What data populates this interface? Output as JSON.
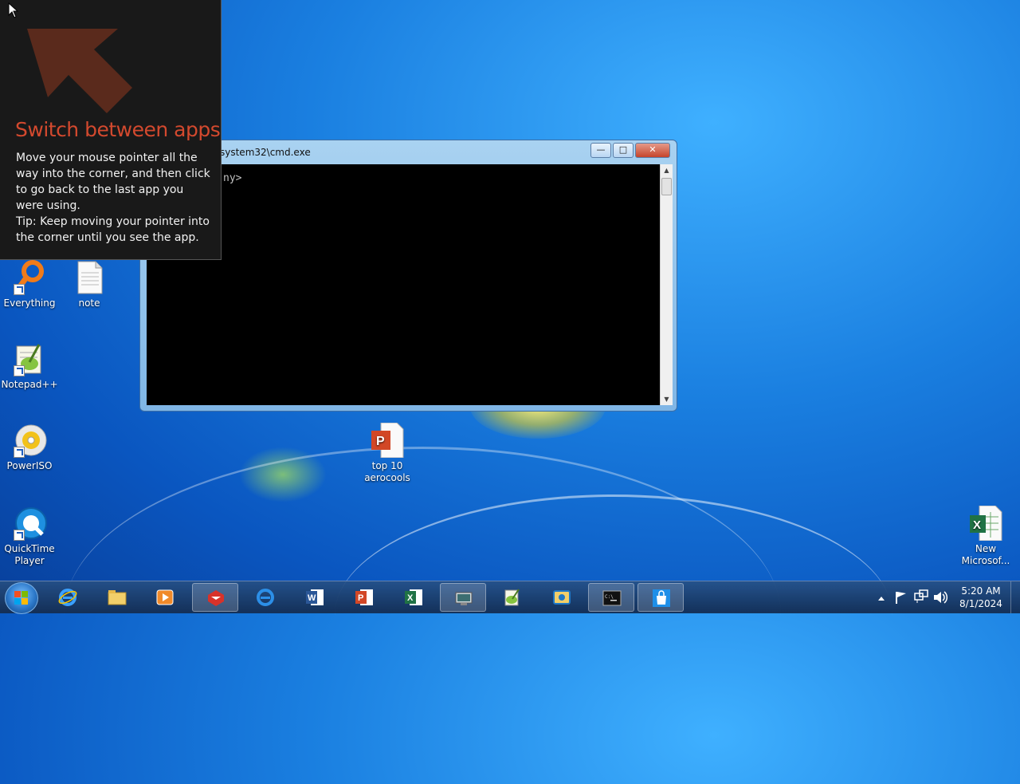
{
  "tip": {
    "title": "Switch between apps",
    "body": "Move your mouse pointer all the way into the corner, and then click to go back to the last app you were using.",
    "tip": "Tip: Keep moving your pointer into the corner until you see the app."
  },
  "cmd": {
    "title": "system32\\cmd.exe",
    "prompt": "ny>",
    "minimize": "—",
    "maximize": "□",
    "close": "✕"
  },
  "desktop_icons": [
    {
      "label": "Everything",
      "icon": "everything-icon"
    },
    {
      "label": "note",
      "icon": "text-file-icon"
    },
    {
      "label": "Notepad++",
      "icon": "notepad-plus-plus-icon"
    },
    {
      "label": "PowerISO",
      "icon": "poweriso-icon"
    },
    {
      "label": "QuickTime Player",
      "icon": "quicktime-icon"
    },
    {
      "label": "top 10 aerocools",
      "icon": "powerpoint-file-icon"
    },
    {
      "label": "New Microsof...",
      "icon": "excel-file-icon"
    }
  ],
  "taskbar": {
    "items": [
      {
        "name": "internet-explorer",
        "active": false
      },
      {
        "name": "file-explorer",
        "active": false
      },
      {
        "name": "media-player",
        "active": false
      },
      {
        "name": "app-red",
        "active": true
      },
      {
        "name": "ie-alt",
        "active": false
      },
      {
        "name": "word",
        "active": false
      },
      {
        "name": "powerpoint",
        "active": false
      },
      {
        "name": "excel",
        "active": false
      },
      {
        "name": "device-manager",
        "active": true
      },
      {
        "name": "notepad-plus-plus",
        "active": false
      },
      {
        "name": "explorer-alt",
        "active": false
      },
      {
        "name": "cmd",
        "active": true
      },
      {
        "name": "store",
        "active": true
      }
    ]
  },
  "clock": {
    "time": "5:20 AM",
    "date": "8/1/2024"
  },
  "colors": {
    "tip_title": "#d3492e",
    "tip_bg": "#191919",
    "desktop": "#1a7fe0"
  }
}
